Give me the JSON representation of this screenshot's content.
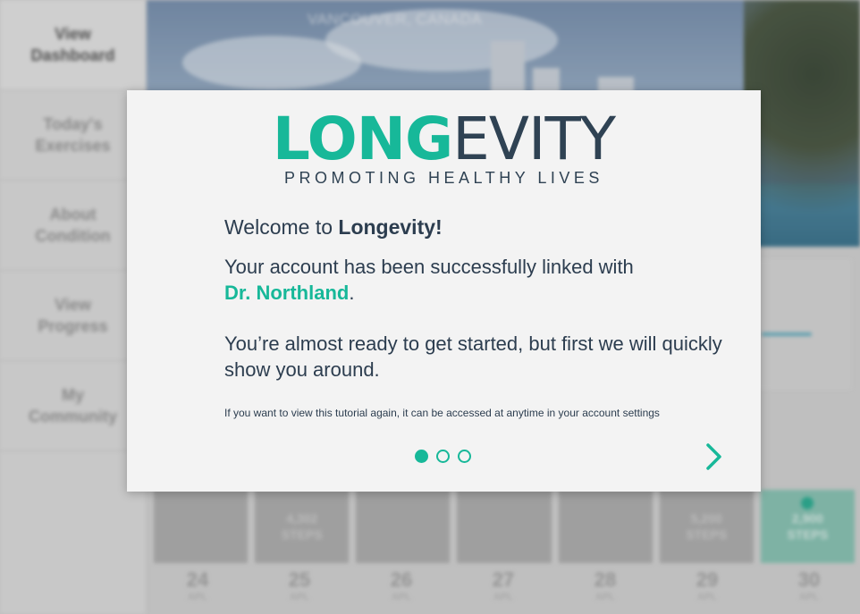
{
  "sidebar": {
    "items": [
      {
        "label_line1": "View",
        "label_line2": "Dashboard"
      },
      {
        "label_line1": "Today's",
        "label_line2": "Exercises"
      },
      {
        "label_line1": "About",
        "label_line2": "Condition"
      },
      {
        "label_line1": "View",
        "label_line2": "Progress"
      },
      {
        "label_line1": "My",
        "label_line2": "Community"
      }
    ]
  },
  "hero": {
    "location": "VANCOUVER, CANADA"
  },
  "week": {
    "cards": [
      {
        "steps": "",
        "unit": ""
      },
      {
        "steps": "4,302",
        "unit": "STEPS"
      },
      {
        "steps": "",
        "unit": ""
      },
      {
        "steps": "",
        "unit": ""
      },
      {
        "steps": "",
        "unit": ""
      },
      {
        "steps": "5,200",
        "unit": "STEPS"
      },
      {
        "steps": "2,900",
        "unit": "STEPS"
      }
    ],
    "dates": [
      {
        "day": "24",
        "month": "APL"
      },
      {
        "day": "25",
        "month": "APL"
      },
      {
        "day": "26",
        "month": "APL"
      },
      {
        "day": "27",
        "month": "APL"
      },
      {
        "day": "28",
        "month": "APL"
      },
      {
        "day": "29",
        "month": "APL"
      },
      {
        "day": "30",
        "month": "APL"
      }
    ]
  },
  "modal": {
    "logo_part1": "LONG",
    "logo_part2": "EVITY",
    "tagline": "PROMOTING HEALTHY LIVES",
    "welcome_prefix": "Welcome to ",
    "welcome_brand": "Longevity!",
    "linked_text": "Your account has been successfully linked with",
    "doctor_name": "Dr. Northland",
    "doctor_suffix": ".",
    "ready_text": "You’re almost ready to get started, but first we will quickly show you around.",
    "note_text": "If you want to view this tutorial again, it can be  accessed at anytime in your account settings",
    "pagination": {
      "current": 1,
      "total": 3
    }
  },
  "colors": {
    "accent": "#17b899",
    "navy": "#2f4253",
    "modal_bg": "#f3f3f3"
  },
  "icons": {
    "next": "chevron-right-icon"
  }
}
